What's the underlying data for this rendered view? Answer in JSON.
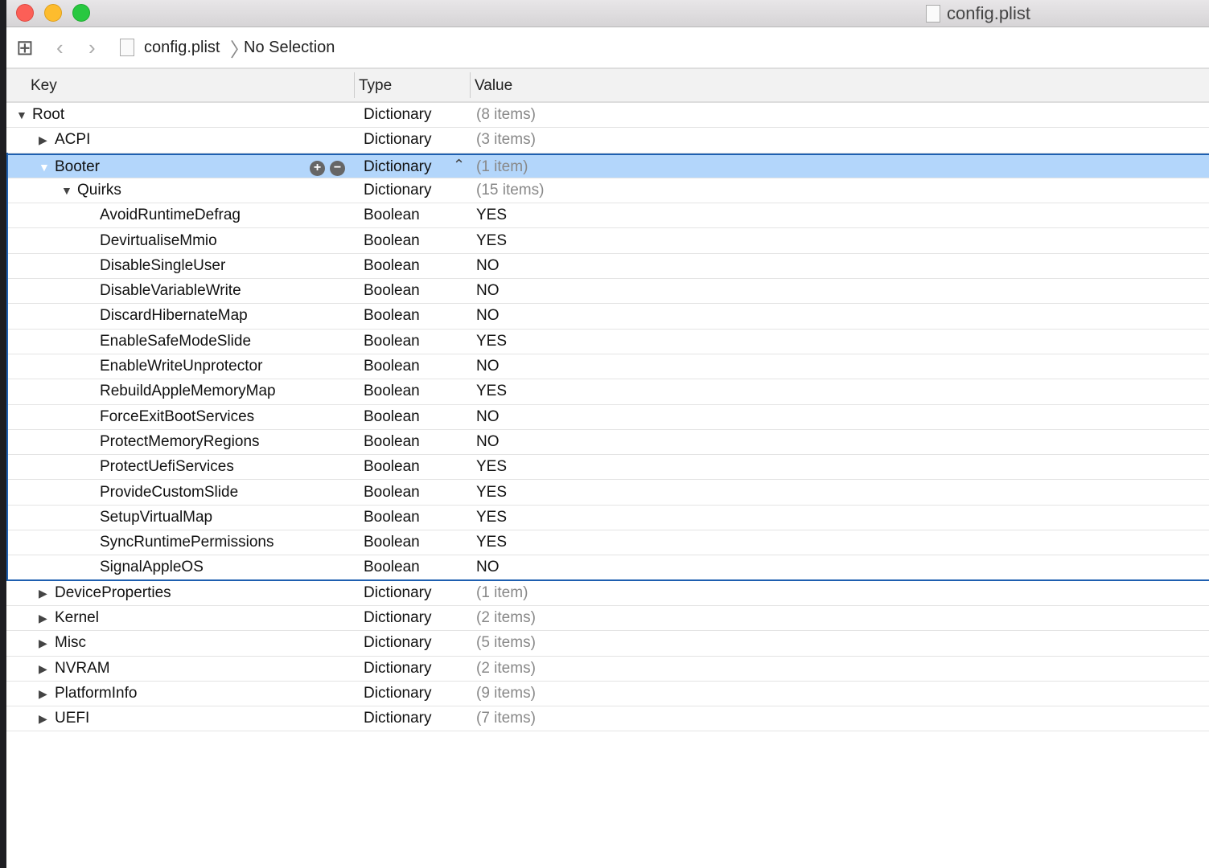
{
  "window": {
    "title": "config.plist"
  },
  "toolbar": {
    "file": "config.plist",
    "selection": "No Selection"
  },
  "columns": {
    "key": "Key",
    "type": "Type",
    "value": "Value"
  },
  "rows": [
    {
      "key": "Root",
      "type": "Dictionary",
      "value": "(8 items)",
      "level": 0,
      "state": "open"
    },
    {
      "key": "ACPI",
      "type": "Dictionary",
      "value": "(3 items)",
      "level": 1,
      "state": "closed"
    },
    {
      "key": "Booter",
      "type": "Dictionary",
      "value": "(1 item)",
      "level": 1,
      "state": "open",
      "selected": true
    },
    {
      "key": "Quirks",
      "type": "Dictionary",
      "value": "(15 items)",
      "level": 2,
      "state": "open"
    },
    {
      "key": "AvoidRuntimeDefrag",
      "type": "Boolean",
      "value": "YES",
      "level": 3
    },
    {
      "key": "DevirtualiseMmio",
      "type": "Boolean",
      "value": "YES",
      "level": 3
    },
    {
      "key": "DisableSingleUser",
      "type": "Boolean",
      "value": "NO",
      "level": 3
    },
    {
      "key": "DisableVariableWrite",
      "type": "Boolean",
      "value": "NO",
      "level": 3
    },
    {
      "key": "DiscardHibernateMap",
      "type": "Boolean",
      "value": "NO",
      "level": 3
    },
    {
      "key": "EnableSafeModeSlide",
      "type": "Boolean",
      "value": "YES",
      "level": 3
    },
    {
      "key": "EnableWriteUnprotector",
      "type": "Boolean",
      "value": "NO",
      "level": 3
    },
    {
      "key": "RebuildAppleMemoryMap",
      "type": "Boolean",
      "value": "YES",
      "level": 3
    },
    {
      "key": "ForceExitBootServices",
      "type": "Boolean",
      "value": "NO",
      "level": 3
    },
    {
      "key": "ProtectMemoryRegions",
      "type": "Boolean",
      "value": "NO",
      "level": 3
    },
    {
      "key": "ProtectUefiServices",
      "type": "Boolean",
      "value": "YES",
      "level": 3
    },
    {
      "key": "ProvideCustomSlide",
      "type": "Boolean",
      "value": "YES",
      "level": 3
    },
    {
      "key": "SetupVirtualMap",
      "type": "Boolean",
      "value": "YES",
      "level": 3
    },
    {
      "key": "SyncRuntimePermissions",
      "type": "Boolean",
      "value": "YES",
      "level": 3
    },
    {
      "key": "SignalAppleOS",
      "type": "Boolean",
      "value": "NO",
      "level": 3
    },
    {
      "key": "DeviceProperties",
      "type": "Dictionary",
      "value": "(1 item)",
      "level": 1,
      "state": "closed"
    },
    {
      "key": "Kernel",
      "type": "Dictionary",
      "value": "(2 items)",
      "level": 1,
      "state": "closed"
    },
    {
      "key": "Misc",
      "type": "Dictionary",
      "value": "(5 items)",
      "level": 1,
      "state": "closed"
    },
    {
      "key": "NVRAM",
      "type": "Dictionary",
      "value": "(2 items)",
      "level": 1,
      "state": "closed"
    },
    {
      "key": "PlatformInfo",
      "type": "Dictionary",
      "value": "(9 items)",
      "level": 1,
      "state": "closed"
    },
    {
      "key": "UEFI",
      "type": "Dictionary",
      "value": "(7 items)",
      "level": 1,
      "state": "closed"
    }
  ]
}
